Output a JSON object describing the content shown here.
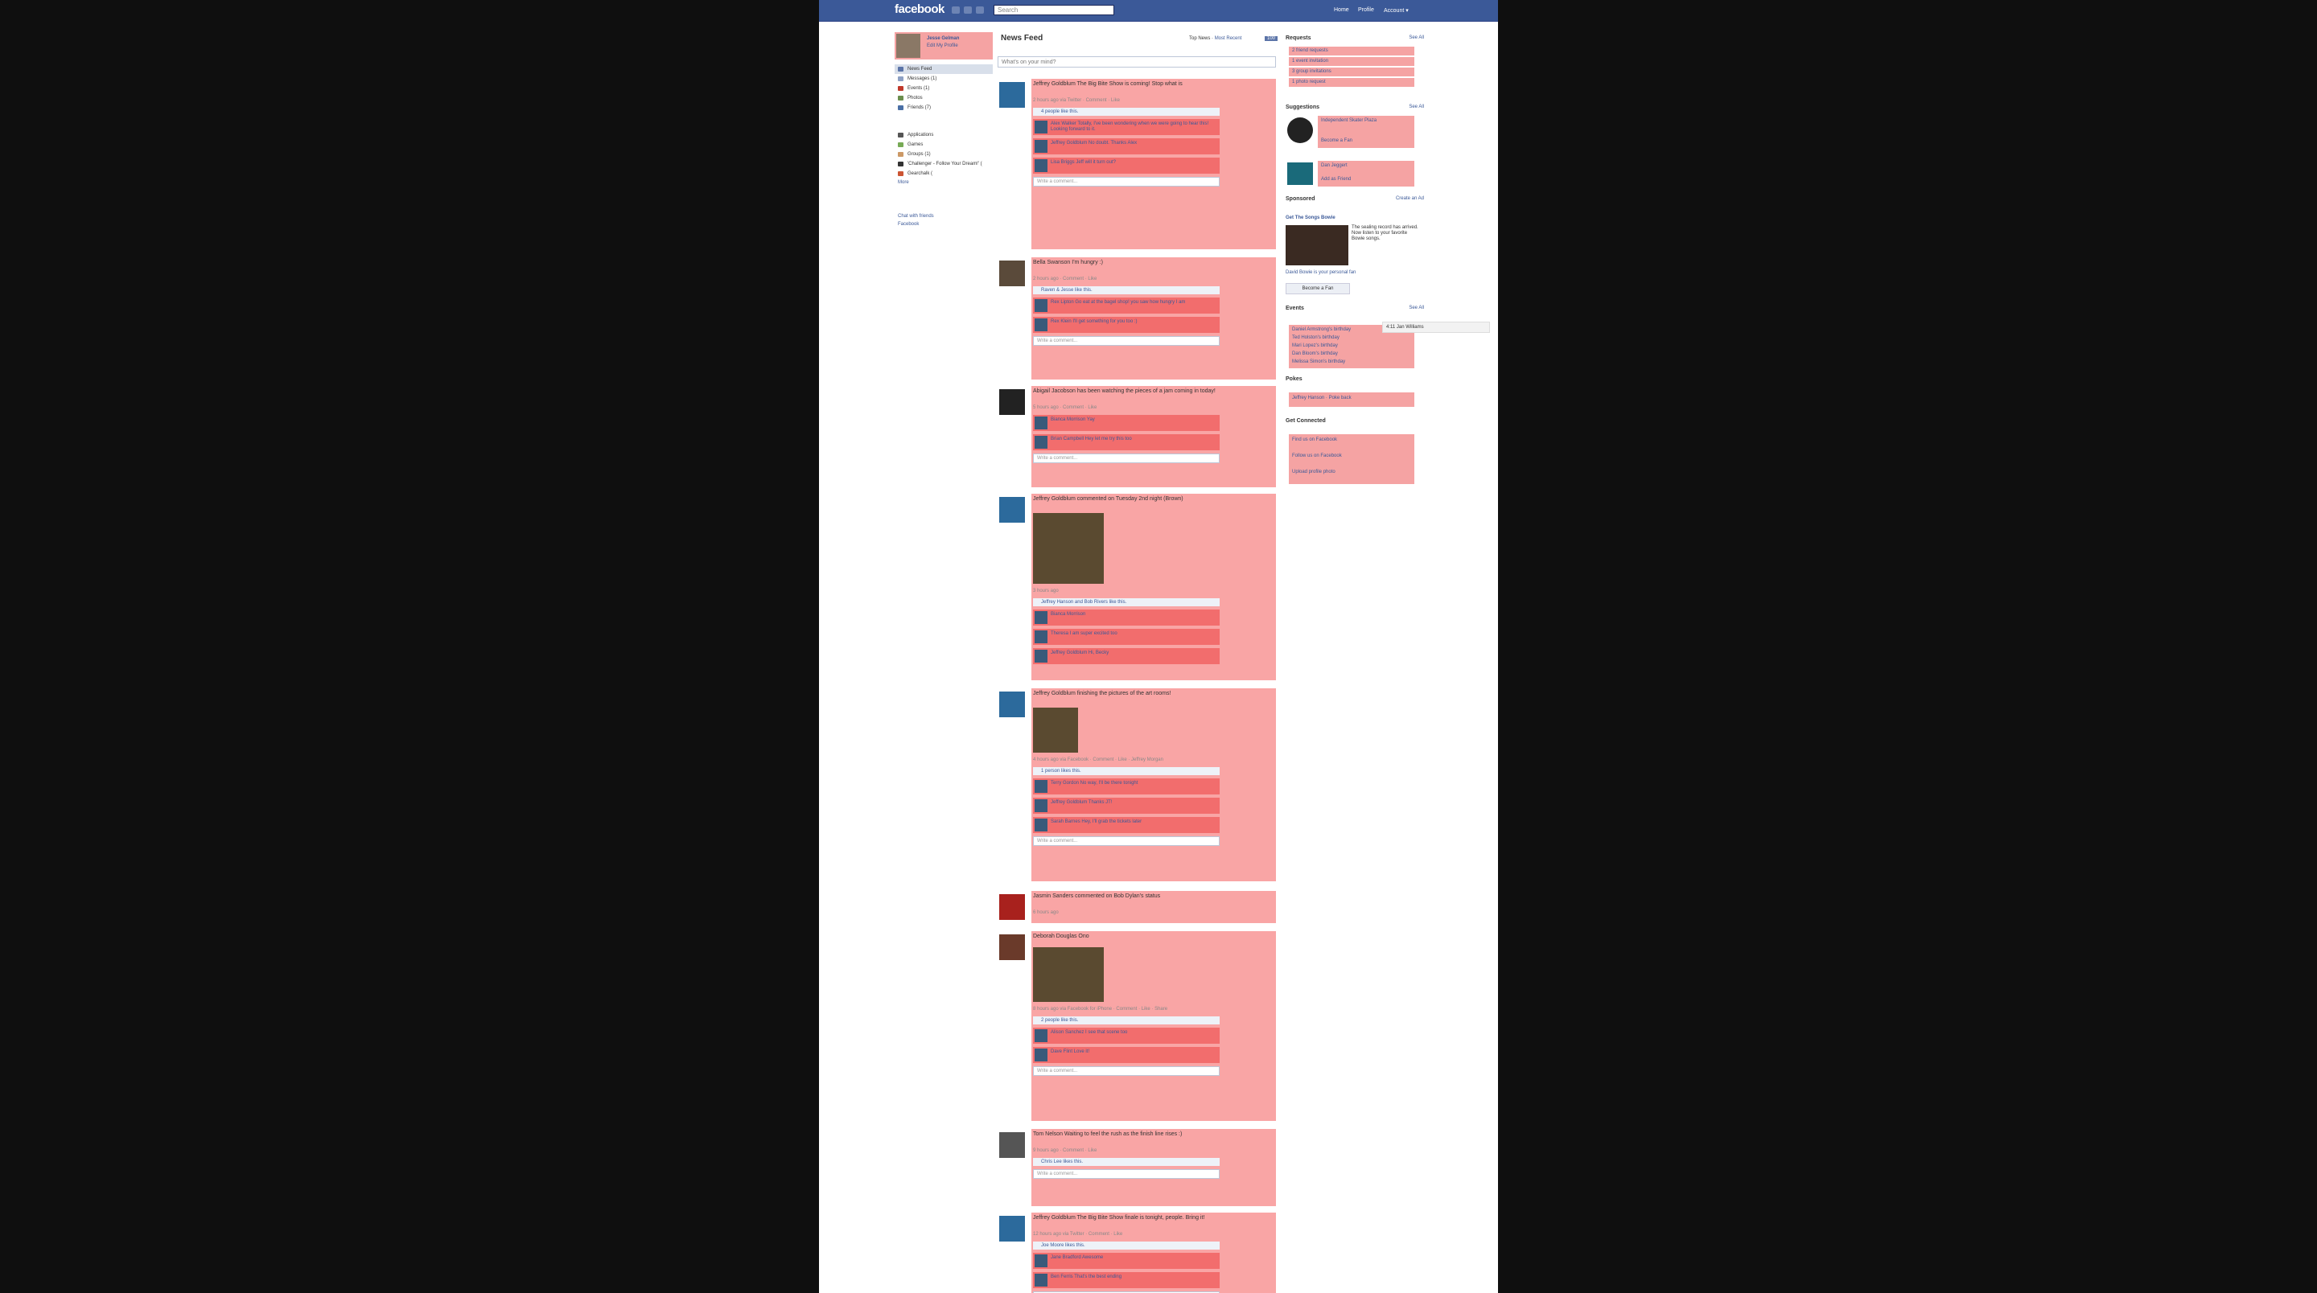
{
  "topbar": {
    "logo": "facebook",
    "search_placeholder": "Search",
    "links": [
      "Home",
      "Profile",
      "Account ▾"
    ]
  },
  "profile": {
    "name": "Jesse Gelman",
    "edit": "Edit My Profile"
  },
  "nav_primary": [
    {
      "label": "News Feed",
      "color": "#5b74a8"
    },
    {
      "label": "Messages (1)",
      "color": "#8da0c4"
    },
    {
      "label": "Events (1)",
      "color": "#c0392b"
    },
    {
      "label": "Photos",
      "color": "#6b8e4e"
    },
    {
      "label": "Friends (7)",
      "color": "#4a6fa5"
    }
  ],
  "nav_secondary": [
    {
      "label": "Applications",
      "color": "#555"
    },
    {
      "label": "Games",
      "color": "#7a5"
    },
    {
      "label": "Groups (1)",
      "color": "#c96"
    },
    {
      "label": "'Challenger - Follow Your Dream!' (",
      "color": "#333"
    },
    {
      "label": "Gearchalk (",
      "color": "#c53"
    }
  ],
  "nav_more": "More",
  "nav_footer": [
    "Chat with friends",
    "Facebook"
  ],
  "feed": {
    "title": "News Feed",
    "sort_label": "Top News",
    "sort_alt": "Most Recent",
    "badge": "100",
    "status_placeholder": "What's on your mind?"
  },
  "stories": [
    {
      "text": "Jeffrey Goldblum The Big Bite Show is coming! Stop what is",
      "meta": "2 hours ago via Twitter · Comment · Like",
      "likes": "4 people like this.",
      "comments": [
        "Alex Walker Totally, I've been wondering when we were going to hear this! Looking forward to it.",
        "Jeffrey Goldblum No doubt. Thanks Alex",
        "Lisa Briggs Jeff will it turn out?"
      ],
      "write": "Write a comment..."
    },
    {
      "text": "Bella Swanson I'm hungry :)",
      "meta": "2 hours ago · Comment · Like",
      "likes": "Raven & Jesse like this.",
      "comments": [
        "Rex Lipton Go eat at the bagel shop! you saw how hungry I am",
        "Rex Klein I'll get something for you too :)"
      ],
      "write": "Write a comment..."
    },
    {
      "text": "Abigail Jacobson has been watching the pieces of a jam coming in today!",
      "meta": "5 hours ago · Comment · Like",
      "likes": "",
      "comments": [
        "Bianca Morrison Yay",
        "Brian Campbell Hey let me try this too"
      ],
      "write": "Write a comment..."
    },
    {
      "text": "Jeffrey Goldblum commented on Tuesday 2nd night (Brown)",
      "meta": "3 hours ago",
      "likes": "Jeffrey Hanson and Bob Rivers like this.",
      "comments": [
        "Bianca Morrison",
        "Theresa I am super excited too",
        "Jeffrey Goldblum Hi, Becky"
      ],
      "write": ""
    },
    {
      "text": "Jeffrey Goldblum finishing the pictures of the art rooms!",
      "meta": "4 hours ago via Facebook · Comment · Like · Jeffrey Morgan",
      "likes": "1 person likes this.",
      "comments": [
        "Terry Gordon No way, I'll be there tonight",
        "Jeffrey Goldblum Thanks JT!",
        "Sarah Barnes Hey, I'll grab the tickets later"
      ],
      "write": "Write a comment..."
    },
    {
      "text": "Jasmin Sanders commented on Bob Dylan's status",
      "meta": "6 hours ago",
      "likes": "",
      "comments": [],
      "write": ""
    },
    {
      "text": "Deborah Douglas Ono",
      "meta": "8 hours ago via Facebook for iPhone · Comment · Like · Share",
      "likes": "2 people like this.",
      "comments": [
        "Alison Sanchez I see that scene too",
        "Dave Flint Love it!"
      ],
      "write": "Write a comment..."
    },
    {
      "text": "Tom Nelson Waiting to feel the rush as the finish line rises :)",
      "meta": "9 hours ago · Comment · Like",
      "likes": "Chris Lee likes this.",
      "comments": [],
      "write": "Write a comment..."
    },
    {
      "text": "Jeffrey Goldblum The Big Bite Show finale is tonight, people. Bring it!",
      "meta": "12 hours ago via Twitter · Comment · Like",
      "likes": "Joe Moore likes this.",
      "comments": [
        "Jane Bradford Awesome",
        "Ben Ferris That's the best ending"
      ],
      "write": "Write a comment..."
    }
  ],
  "right": {
    "requests_title": "Requests",
    "see_all": "See All",
    "requests": [
      "2 friend requests",
      "1 event invitation",
      "3 group invitations",
      "1 photo request"
    ],
    "suggestions_title": "Suggestions",
    "suggestions": [
      {
        "name": "Independent Skater Plaza",
        "action": "Become a Fan"
      },
      {
        "name": "Dan Jeggert",
        "action": "Add as Friend"
      }
    ],
    "sponsored_title": "Sponsored",
    "sponsored_link": "Create an Ad",
    "ad_title": "Get The Songs Bowie",
    "ad_text": "The sealing record has arrived. Now listen to your favorite Bowie songs.",
    "ad_footer": "David Bowie is your personal fan",
    "ad_button": "Become a Fan",
    "events_title": "Events",
    "events": [
      "Daniel Armstrong's birthday",
      "Ted Holston's birthday",
      "Mari Lopez's birthday",
      "Dan Bloom's birthday",
      "Melissa Simon's birthday"
    ],
    "tooltip": "4:11 Jan Williams",
    "pokes_title": "Pokes",
    "pokes": [
      "Jeffrey Hanson · Poke back"
    ],
    "connect_title": "Get Connected",
    "connect": [
      "Find us on Facebook",
      "Follow us on Facebook",
      "Upload profile photo"
    ]
  }
}
